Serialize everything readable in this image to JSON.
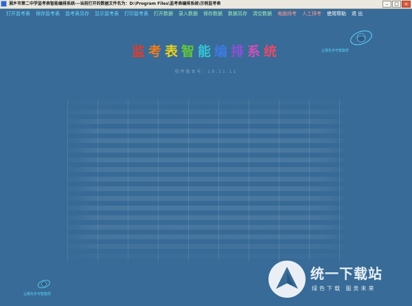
{
  "window": {
    "title": "湘乡市第二中学监考表智能编排系统---当前打开的数据文件名为：D:\\Program Files\\监考表编排系统\\示例监考表"
  },
  "menu": [
    {
      "label": "打开监考表",
      "tone": "blue"
    },
    {
      "label": "保存监考表",
      "tone": "blue"
    },
    {
      "label": "监考表另存",
      "tone": "blue"
    },
    {
      "label": "显示监考表",
      "tone": "blue"
    },
    {
      "label": "打印监考表",
      "tone": "blue"
    },
    {
      "label": "打开数据",
      "tone": "green"
    },
    {
      "label": "录入数据",
      "tone": "green"
    },
    {
      "label": "保存数据",
      "tone": "green"
    },
    {
      "label": "数据另存",
      "tone": "green"
    },
    {
      "label": "清空数据",
      "tone": "green"
    },
    {
      "label": "电脑排考",
      "tone": "red"
    },
    {
      "label": "人工排考",
      "tone": "red"
    },
    {
      "label": "使用帮助",
      "tone": "white"
    },
    {
      "label": "退 出",
      "tone": "white"
    }
  ],
  "main": {
    "title": "监考表智能编排系统",
    "title_colors": [
      "#e33b2e",
      "#f07c1d",
      "#e8d21c",
      "#63c93a",
      "#34c6d6",
      "#3d7be0",
      "#8f4fd8",
      "#d04fb8",
      "#e64a6a"
    ],
    "version": "软件版本号：19.11.11"
  },
  "logos": {
    "top_right_text": "让我先手可智能样",
    "bottom_left_text": "让我先手可智能样"
  },
  "watermark": {
    "name": "统一下载站",
    "slogan": "绿色下载  服务未来"
  },
  "colors": {
    "background": "#386b97",
    "menu_blue": "#6ed6ff",
    "menu_green": "#9df0b9",
    "menu_red": "#ff9a91"
  }
}
